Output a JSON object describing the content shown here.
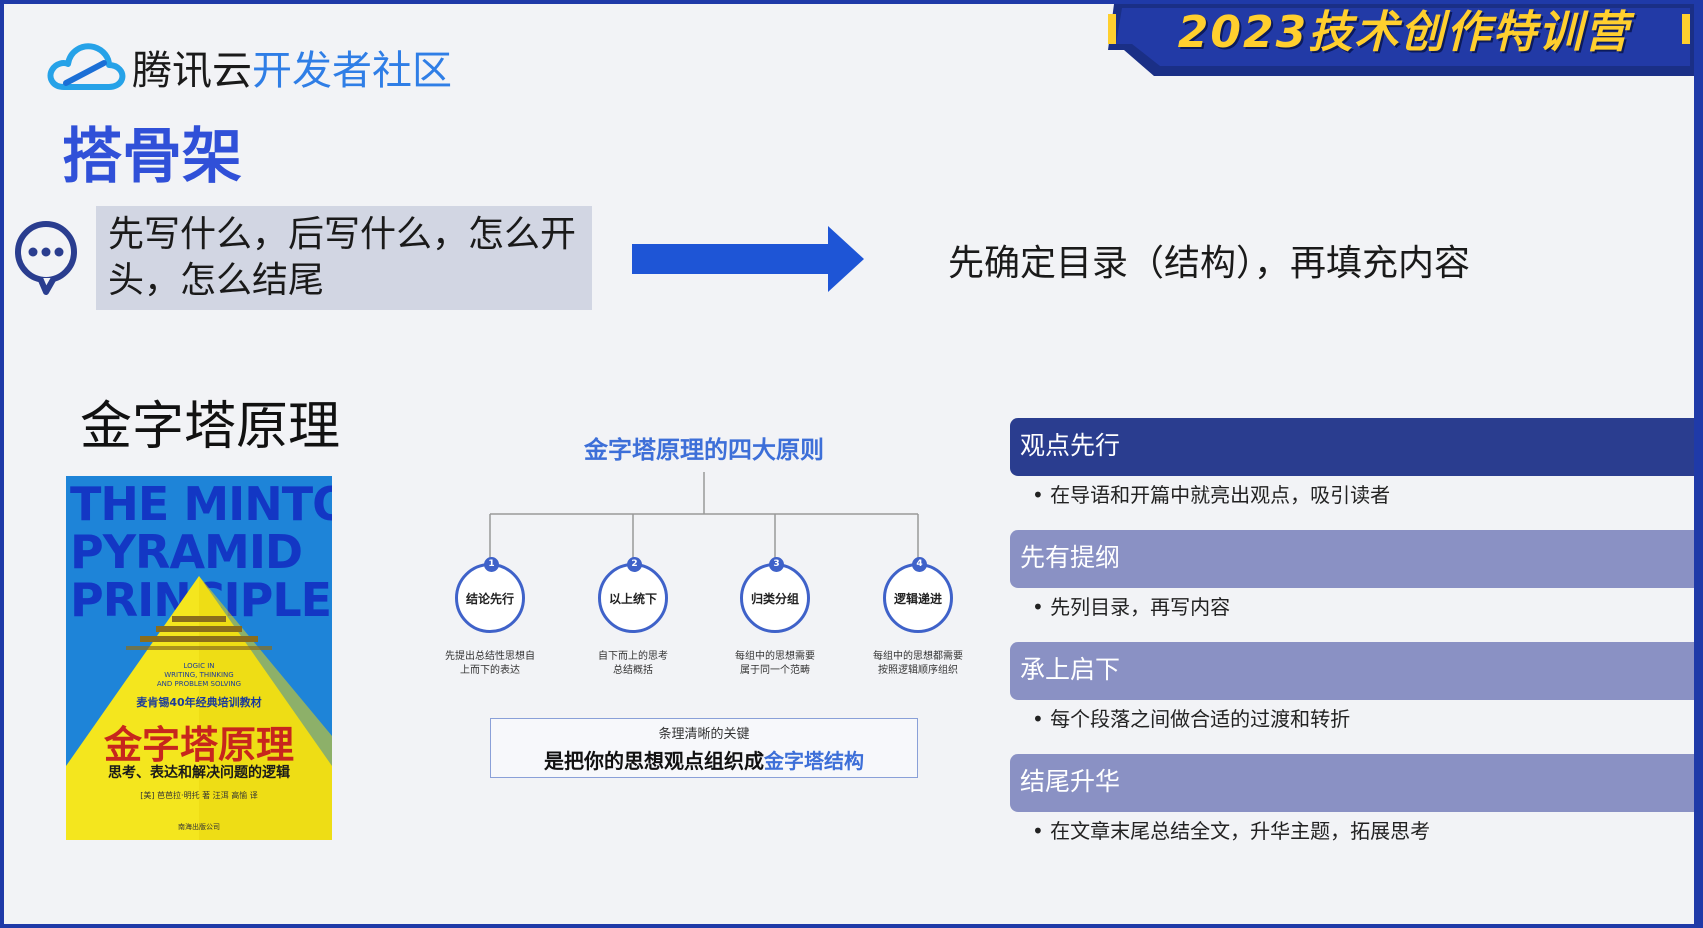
{
  "banner": {
    "text": "2023技术创作特训营"
  },
  "logo": {
    "brand": "腾讯云",
    "community": "开发者社区"
  },
  "title": "搭骨架",
  "question": {
    "text": "先写什么，后写什么，怎么开头，怎么结尾"
  },
  "answer": "先确定目录（结构），再填充内容",
  "section": {
    "title": "金字塔原理"
  },
  "book": {
    "title_en_lines": [
      "THE MINTO",
      "PYRAMID",
      "PRINCIPLE"
    ],
    "subtitle_en_lines": [
      "LOGIC IN",
      "WRITING, THINKING",
      "AND PROBLEM SOLVING"
    ],
    "tagline": "麦肯锡40年经典培训教材",
    "title_cn": "金字塔原理",
    "desc": "思考、表达和解决问题的逻辑",
    "author": "[美] 芭芭拉·明托 著  汪洱 高愉 译",
    "publisher": "南海出版公司"
  },
  "diagram": {
    "title": "金字塔原理的四大原则",
    "nodes": [
      {
        "num": "1",
        "label": "结论先行",
        "desc": [
          "先提出总结性思想自",
          "上而下的表达"
        ]
      },
      {
        "num": "2",
        "label": "以上统下",
        "desc": [
          "自下而上的思考",
          "总结概括"
        ]
      },
      {
        "num": "3",
        "label": "归类分组",
        "desc": [
          "每组中的思想需要",
          "属于同一个范畴"
        ]
      },
      {
        "num": "4",
        "label": "逻辑递进",
        "desc": [
          "每组中的思想都需要",
          "按照逻辑顺序组织"
        ]
      }
    ],
    "key_small": "条理清晰的关键",
    "key_big_prefix": "是把你的思想观点组织成",
    "key_big_highlight": "金字塔结构"
  },
  "principles": [
    {
      "title": "观点先行",
      "desc": "在导语和开篇中就亮出观点，吸引读者",
      "style": "dark"
    },
    {
      "title": "先有提纲",
      "desc": "先列目录，再写内容",
      "style": "light"
    },
    {
      "title": "承上启下",
      "desc": "每个段落之间做合适的过渡和转折",
      "style": "light"
    },
    {
      "title": "结尾升华",
      "desc": "在文章末尾总结全文，升华主题，拓展思考",
      "style": "light"
    }
  ],
  "colors": {
    "frame": "#1f3aa8",
    "title_blue": "#3050d8",
    "arrow_blue": "#1e55d6",
    "header_dark": "#2a3d8f",
    "header_light": "#8a91c4",
    "banner_yellow": "#ffcf2e"
  }
}
